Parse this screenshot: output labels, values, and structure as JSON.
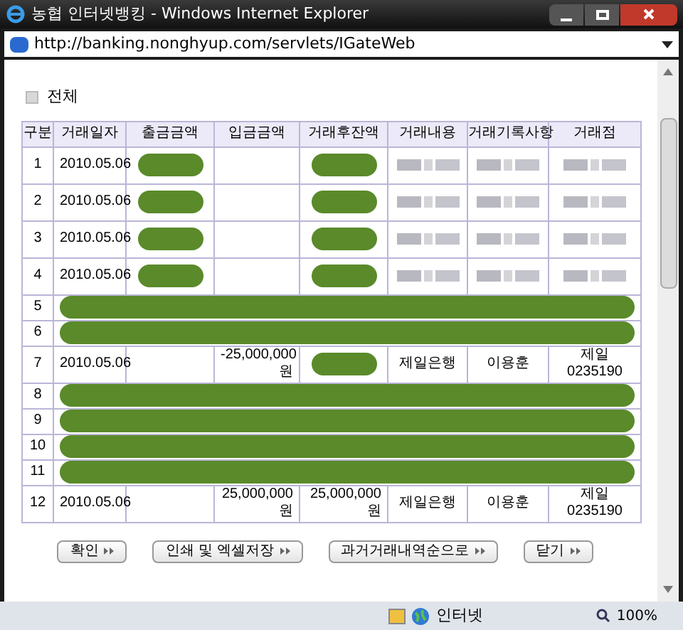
{
  "window": {
    "title": "농협 인터넷뱅킹 - Windows Internet Explorer"
  },
  "address_bar": {
    "url": "http://banking.nonghyup.com/servlets/IGateWeb"
  },
  "section": {
    "label": "전체"
  },
  "table": {
    "columns": [
      "구분",
      "거래일자",
      "출금금액",
      "입금금액",
      "거래후잔액",
      "거래내용",
      "거래기록사항",
      "거래점"
    ],
    "rows": [
      {
        "no": "1",
        "kind": "partial",
        "cells": [
          "2010.05.06",
          {
            "kind": "redacted"
          },
          "",
          {
            "kind": "redacted"
          },
          {
            "kind": "blurred"
          },
          {
            "kind": "blurred"
          },
          {
            "kind": "blurred"
          }
        ]
      },
      {
        "no": "2",
        "kind": "partial",
        "cells": [
          "2010.05.06",
          {
            "kind": "redacted"
          },
          "",
          {
            "kind": "redacted"
          },
          {
            "kind": "blurred"
          },
          {
            "kind": "blurred"
          },
          {
            "kind": "blurred"
          }
        ]
      },
      {
        "no": "3",
        "kind": "partial",
        "cells": [
          "2010.05.06",
          {
            "kind": "redacted"
          },
          "",
          {
            "kind": "redacted"
          },
          {
            "kind": "blurred"
          },
          {
            "kind": "blurred"
          },
          {
            "kind": "blurred"
          }
        ]
      },
      {
        "no": "4",
        "kind": "partial",
        "cells": [
          "2010.05.06",
          {
            "kind": "redacted"
          },
          "",
          {
            "kind": "redacted"
          },
          {
            "kind": "blurred"
          },
          {
            "kind": "blurred"
          },
          {
            "kind": "blurred"
          }
        ]
      },
      {
        "no": "5",
        "kind": "redacted"
      },
      {
        "no": "6",
        "kind": "redacted"
      },
      {
        "no": "7",
        "kind": "partial",
        "cells": [
          "2010.05.06",
          "",
          "-25,000,000 원",
          {
            "kind": "redacted"
          },
          "제일은행",
          "이용훈",
          "제일 0235190"
        ]
      },
      {
        "no": "8",
        "kind": "redacted"
      },
      {
        "no": "9",
        "kind": "redacted"
      },
      {
        "no": "10",
        "kind": "redacted"
      },
      {
        "no": "11",
        "kind": "redacted"
      },
      {
        "no": "12",
        "kind": "partial",
        "cells": [
          "2010.05.06",
          "",
          "25,000,000 원",
          "25,000,000 원",
          "제일은행",
          "이용훈",
          "제일 0235190"
        ]
      }
    ]
  },
  "buttons": [
    "확인",
    "인쇄 및 엑셀저장",
    "과거거래내역순으로",
    "닫기"
  ],
  "status_bar": {
    "zone": "인터넷",
    "zoom": "100%"
  }
}
